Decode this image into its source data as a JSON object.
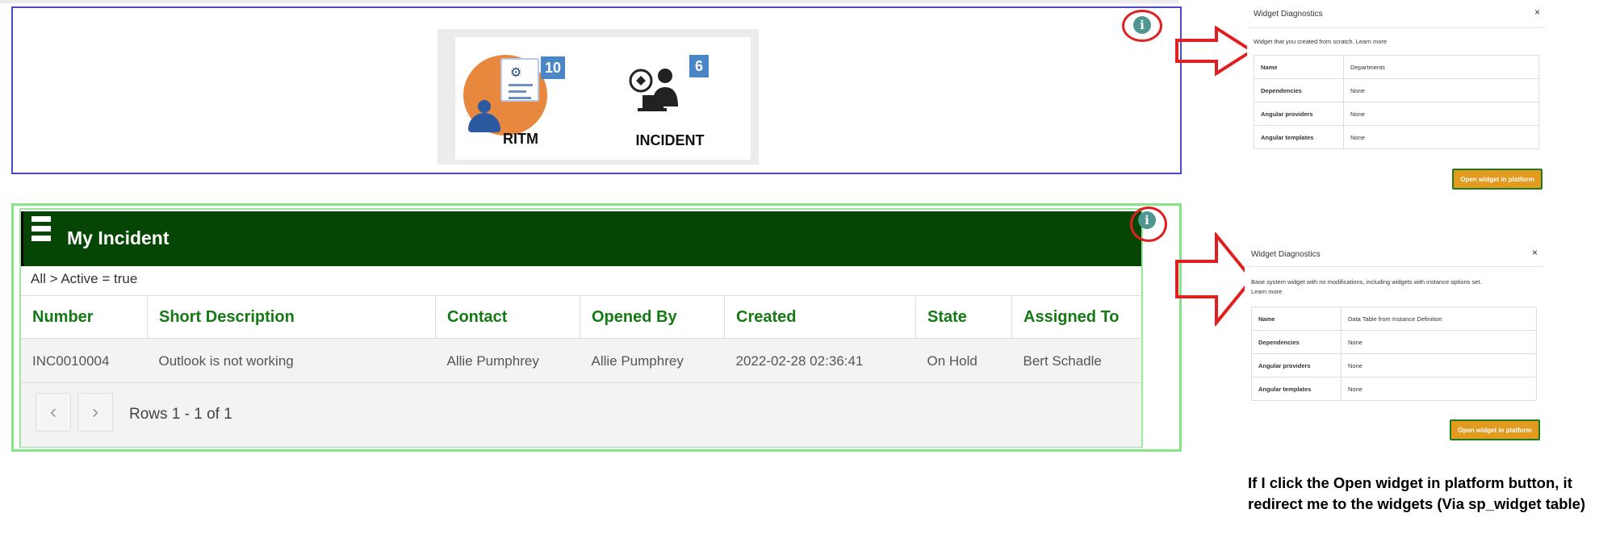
{
  "top_widget": {
    "tiles": [
      {
        "label": "RITM",
        "count": "10"
      },
      {
        "label": "INCIDENT",
        "count": "6"
      }
    ]
  },
  "incident_widget": {
    "title": "My Incident",
    "breadcrumb": "All > Active = true",
    "columns": [
      "Number",
      "Short Description",
      "Contact",
      "Opened By",
      "Created",
      "State",
      "Assigned To"
    ],
    "rows": [
      [
        "INC0010004",
        "Outlook is not working",
        "Allie Pumphrey",
        "Allie Pumphrey",
        "2022-02-28 02:36:41",
        "On Hold",
        "Bert Schadle"
      ]
    ],
    "pager": {
      "prev_icon": "chevron-left-icon",
      "next_icon": "chevron-right-icon",
      "rows_text": "Rows 1 - 1 of 1"
    }
  },
  "diagnostics": [
    {
      "title": "Widget Diagnostics",
      "close": "×",
      "description": "Widget that you created from scratch. Learn more",
      "fields": [
        {
          "key": "Name",
          "value": "Departments"
        },
        {
          "key": "Dependencies",
          "value": "None"
        },
        {
          "key": "Angular providers",
          "value": "None"
        },
        {
          "key": "Angular templates",
          "value": "None"
        }
      ],
      "button": "Open widget in platform"
    },
    {
      "title": "Widget Diagnostics",
      "close": "×",
      "description": "Base system widget with no modifications, including widgets with instance options set.",
      "description_link": "Learn more",
      "fields": [
        {
          "key": "Name",
          "value": "Data Table from Instance Definition"
        },
        {
          "key": "Dependencies",
          "value": "None"
        },
        {
          "key": "Angular providers",
          "value": "None"
        },
        {
          "key": "Angular templates",
          "value": "None"
        }
      ],
      "button": "Open widget in platform"
    }
  ],
  "info_icon": "i",
  "note": "If I click the Open widget in platform button, it redirect me to the widgets (Via sp_widget table)",
  "colors": {
    "header_green": "#054605",
    "heading_text_green": "#157a15",
    "button_orange": "#e29b1f",
    "annotation_red": "#e02020",
    "top_border": "#4a4ac8"
  }
}
